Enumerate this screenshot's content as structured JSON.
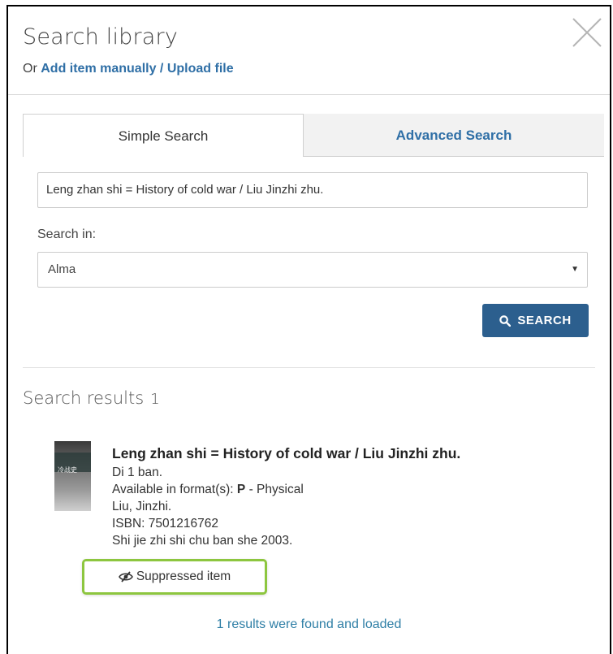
{
  "header": {
    "title": "Search library",
    "or_text": "Or",
    "add_link": "Add item manually / Upload file"
  },
  "tabs": [
    {
      "label": "Simple Search",
      "active": true
    },
    {
      "label": "Advanced Search",
      "active": false
    }
  ],
  "search": {
    "query_value": "Leng zhan shi = History of cold war / Liu Jinzhi zhu.",
    "search_in_label": "Search in:",
    "search_in_value": "Alma",
    "button_label": "SEARCH"
  },
  "results": {
    "title": "Search results",
    "count": "1",
    "items": [
      {
        "title": "Leng zhan shi = History of cold war / Liu Jinzhi zhu.",
        "edition": "Di 1 ban.",
        "format_prefix": "Available in format(s): ",
        "format_code": "P",
        "format_suffix": " - Physical",
        "author": "Liu, Jinzhi.",
        "isbn": "ISBN: 7501216762",
        "publisher": "Shi jie zhi shi chu ban she 2003.",
        "suppressed_label": "Suppressed item"
      }
    ],
    "footer": "1 results were found and loaded"
  },
  "colors": {
    "link": "#2f6fa6",
    "button": "#2c5f8e",
    "highlight": "#8dc63f"
  }
}
